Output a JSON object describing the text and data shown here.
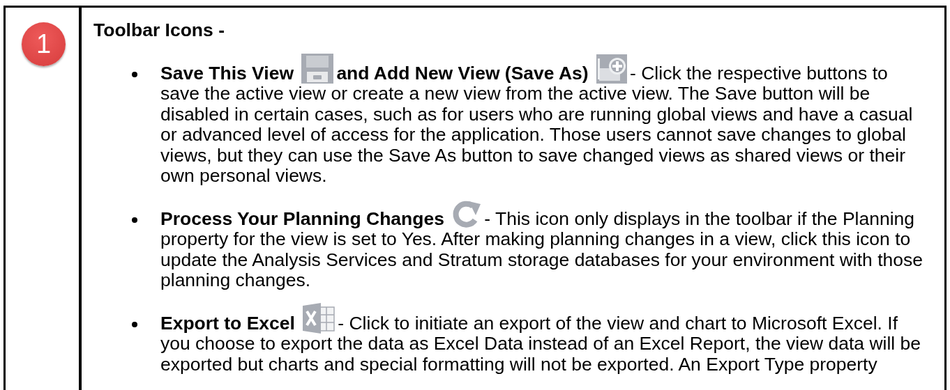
{
  "step_badge": "1",
  "heading": "Toolbar Icons -",
  "bullets": [
    {
      "parts": [
        {
          "kind": "bold",
          "text": "Save This View"
        },
        {
          "kind": "icon"
        },
        {
          "kind": "bold",
          "text": "and Add New View (Save As)"
        },
        {
          "kind": "icon"
        },
        {
          "kind": "text",
          "text": "- Click the respective buttons to save the active view or create a new view from the active view. The Save button will be disabled in certain cases, such as for users who are running global views and have a casual or advanced level of access for the application. Those users cannot save changes to global views, but they can use the Save As button to save changed views as shared views or their own personal views."
        }
      ]
    },
    {
      "parts": [
        {
          "kind": "bold",
          "text": "Process Your Planning Changes"
        },
        {
          "kind": "icon"
        },
        {
          "kind": "text",
          "text": "- This icon only displays in the toolbar if the Planning property for the view is set to Yes. After making planning changes in a view, click this icon to update the Analysis Services and Stratum storage databases for your environment with those planning changes."
        }
      ]
    },
    {
      "parts": [
        {
          "kind": "bold",
          "text": "Export to Excel"
        },
        {
          "kind": "icon"
        },
        {
          "kind": "text",
          "text": "- Click to initiate an export of the view and chart to Microsoft Excel. If you choose to export the data as Excel Data instead of an Excel Report, the view data will be exported but charts and special formatting will not be exported. An Export Type property"
        }
      ]
    }
  ]
}
